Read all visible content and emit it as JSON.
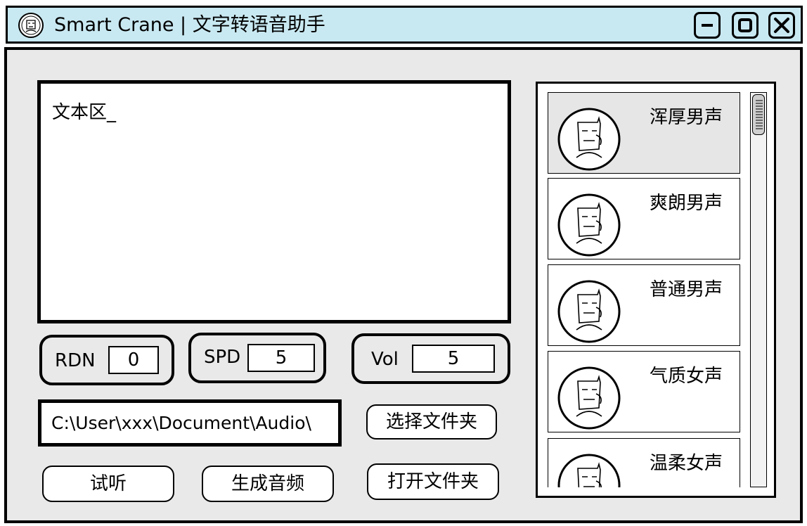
{
  "window": {
    "title": "Smart Crane | 文字转语音助手"
  },
  "titlebar_buttons": {
    "minimize": "minimize-icon",
    "maximize": "maximize-icon",
    "close": "close-icon"
  },
  "editor": {
    "text": "文本区_"
  },
  "params": {
    "rdn": {
      "label": "RDN",
      "value": "0"
    },
    "spd": {
      "label": "SPD",
      "value": "5"
    },
    "vol": {
      "label": "Vol",
      "value": "5"
    }
  },
  "output": {
    "path": "C:\\User\\xxx\\Document\\Audio\\"
  },
  "buttons": {
    "select_folder": "选择文件夹",
    "preview": "试听",
    "generate": "生成音频",
    "open_folder": "打开文件夹"
  },
  "voices": [
    {
      "name": "浑厚男声",
      "selected": true
    },
    {
      "name": "爽朗男声",
      "selected": false
    },
    {
      "name": "普通男声",
      "selected": false
    },
    {
      "name": "气质女声",
      "selected": false
    },
    {
      "name": "温柔女声",
      "selected": false
    }
  ],
  "colors": {
    "titlebar": "#c9e9f2",
    "window": "#e9e9e9",
    "selected_item": "#e6e6e6"
  }
}
